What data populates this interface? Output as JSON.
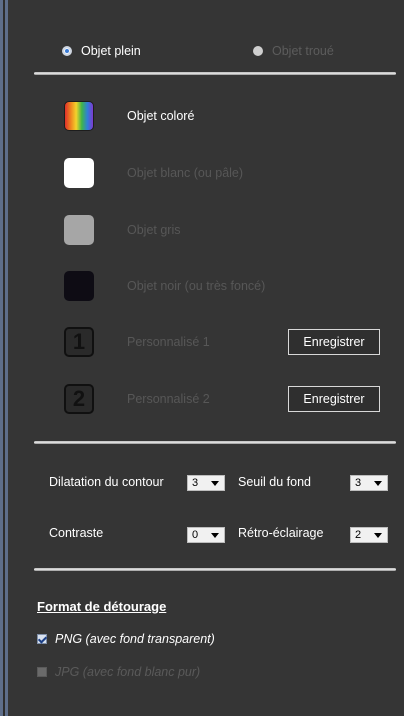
{
  "object_type": {
    "options": [
      {
        "label": "Objet plein",
        "selected": true
      },
      {
        "label": "Objet troué",
        "selected": false
      }
    ]
  },
  "objects": [
    {
      "label": "Objet coloré",
      "swatch": "rainbow",
      "active": true
    },
    {
      "label": "Objet blanc (ou pâle)",
      "swatch": "#ffffff",
      "active": false
    },
    {
      "label": "Objet gris",
      "swatch": "#a6a6a6",
      "active": false
    },
    {
      "label": "Objet noir (ou très foncé)",
      "swatch": "#0e0c14",
      "active": false
    },
    {
      "label": "Personnalisé 1",
      "swatch_number": "1",
      "button": "Enregistrer",
      "active": false
    },
    {
      "label": "Personnalisé 2",
      "swatch_number": "2",
      "button": "Enregistrer",
      "active": false
    }
  ],
  "settings": {
    "dilatation": {
      "label": "Dilatation du contour",
      "value": "3"
    },
    "seuil": {
      "label": "Seuil du fond",
      "value": "3"
    },
    "contraste": {
      "label": "Contraste",
      "value": "0"
    },
    "retro": {
      "label": "Rétro-éclairage",
      "value": "2"
    }
  },
  "format": {
    "title": "Format de détourage",
    "options": [
      {
        "label": "PNG (avec fond transparent)",
        "checked": true
      },
      {
        "label": "JPG (avec fond blanc pur)",
        "checked": false
      }
    ]
  },
  "colors": {
    "background": "#353535",
    "active_text": "#ffffff",
    "dim_text": "#575757"
  }
}
